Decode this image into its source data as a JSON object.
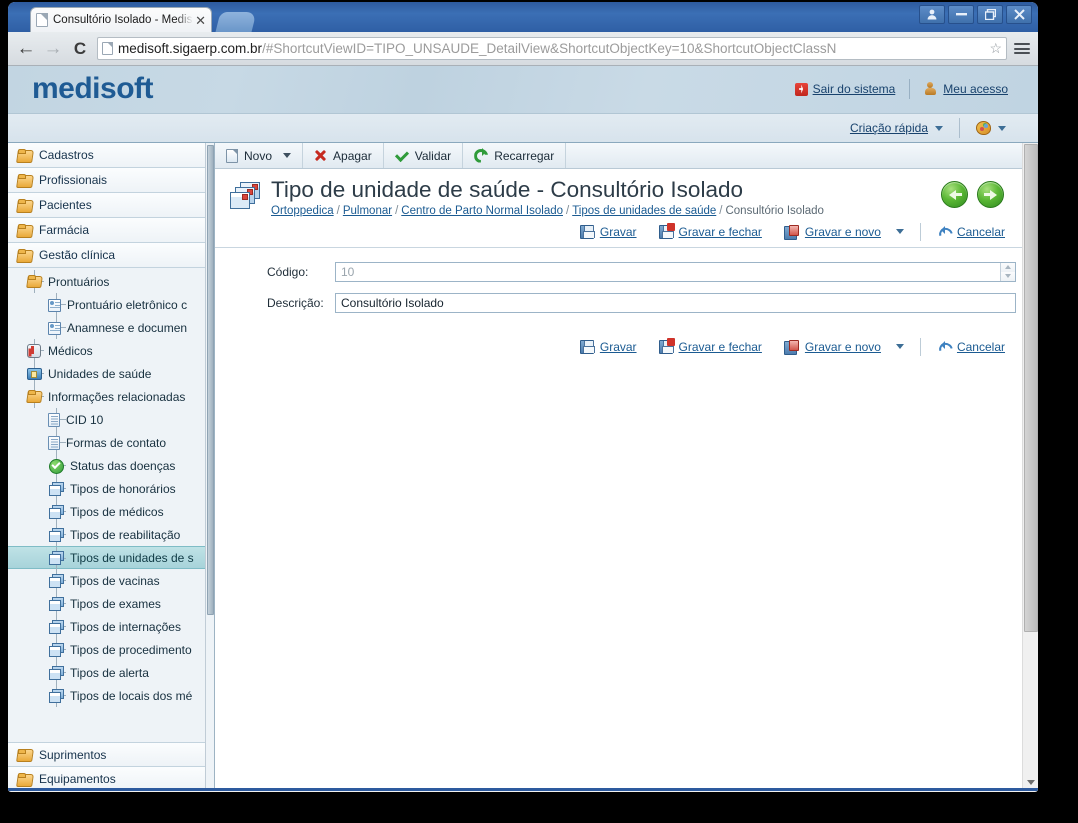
{
  "browser": {
    "tab_title": "Consultório Isolado - Medisof",
    "tab_close": "✕",
    "url_host": "medisoft.sigaerp.com.br",
    "url_path": "/#ShortcutViewID=TIPO_UNSAUDE_DetailView&ShortcutObjectKey=10&ShortcutObjectClassN",
    "back": "←",
    "forward": "→",
    "reload": "C",
    "star": "☆",
    "window_controls": [
      "user-icon",
      "minimize",
      "restore",
      "close"
    ]
  },
  "app": {
    "logo": "medisoft",
    "header_links": [
      {
        "label": "Sair do sistema",
        "icon": "exit-icon"
      },
      {
        "label": "Meu acesso",
        "icon": "user-icon"
      }
    ],
    "subheader": {
      "quick_create": "Criação rápida",
      "theme_icon": "palette-icon"
    }
  },
  "sidebar": {
    "groups_top": [
      {
        "label": "Cadastros"
      },
      {
        "label": "Profissionais"
      },
      {
        "label": "Pacientes"
      },
      {
        "label": "Farmácia"
      },
      {
        "label": "Gestão clínica"
      }
    ],
    "tree": [
      {
        "label": "Prontuários",
        "level": 1,
        "icon": "folder",
        "expander": "minus",
        "selected": false
      },
      {
        "label": "Prontuário eletrônico c",
        "level": 2,
        "icon": "card",
        "expander": "",
        "selected": false
      },
      {
        "label": "Anamnese e documen",
        "level": 2,
        "icon": "card",
        "expander": "",
        "selected": false
      },
      {
        "label": "Médicos",
        "level": 1,
        "icon": "doctor",
        "expander": "",
        "selected": false
      },
      {
        "label": "Unidades de saúde",
        "level": 1,
        "icon": "house",
        "expander": "",
        "selected": false
      },
      {
        "label": "Informações relacionadas",
        "level": 1,
        "icon": "folder",
        "expander": "minus",
        "selected": false
      },
      {
        "label": "CID 10",
        "level": 2,
        "icon": "doc",
        "expander": "",
        "selected": false
      },
      {
        "label": "Formas de contato",
        "level": 2,
        "icon": "doc",
        "expander": "",
        "selected": false
      },
      {
        "label": "Status das doenças",
        "level": 2,
        "icon": "check",
        "expander": "",
        "selected": false
      },
      {
        "label": "Tipos de honorários",
        "level": 2,
        "icon": "stack",
        "expander": "",
        "selected": false
      },
      {
        "label": "Tipos de médicos",
        "level": 2,
        "icon": "stack",
        "expander": "",
        "selected": false
      },
      {
        "label": "Tipos de reabilitação",
        "level": 2,
        "icon": "stack",
        "expander": "",
        "selected": false
      },
      {
        "label": "Tipos de unidades de s",
        "level": 2,
        "icon": "stack",
        "expander": "",
        "selected": true
      },
      {
        "label": "Tipos de vacinas",
        "level": 2,
        "icon": "stack",
        "expander": "",
        "selected": false
      },
      {
        "label": "Tipos de exames",
        "level": 2,
        "icon": "stack",
        "expander": "",
        "selected": false
      },
      {
        "label": "Tipos de internações",
        "level": 2,
        "icon": "stack",
        "expander": "",
        "selected": false
      },
      {
        "label": "Tipos de procedimento",
        "level": 2,
        "icon": "stack",
        "expander": "",
        "selected": false
      },
      {
        "label": "Tipos de alerta",
        "level": 2,
        "icon": "stack",
        "expander": "",
        "selected": false
      },
      {
        "label": "Tipos de locais dos mé",
        "level": 2,
        "icon": "stack",
        "expander": "",
        "selected": false
      }
    ],
    "groups_bottom": [
      {
        "label": "Suprimentos"
      },
      {
        "label": "Equipamentos"
      }
    ]
  },
  "toolbar": {
    "new": "Novo",
    "delete": "Apagar",
    "validate": "Validar",
    "reload": "Recarregar"
  },
  "page": {
    "title": "Tipo de unidade de saúde - Consultório Isolado",
    "breadcrumb": [
      {
        "label": "Ortoppedica",
        "link": true
      },
      {
        "label": "Pulmonar",
        "link": true
      },
      {
        "label": "Centro de Parto Normal Isolado",
        "link": true
      },
      {
        "label": "Tipos de unidades de saúde",
        "link": true
      },
      {
        "label": "Consultório Isolado",
        "link": false
      }
    ],
    "breadcrumb_sep": "/"
  },
  "actions": {
    "save": "Gravar",
    "save_close": "Gravar e fechar",
    "save_new": "Gravar e novo",
    "cancel": "Cancelar"
  },
  "form": {
    "codigo_label": "Código:",
    "codigo_value": "10",
    "descricao_label": "Descrição:",
    "descricao_value": "Consultório Isolado"
  },
  "colors": {
    "brand_blue": "#1f5b94",
    "link": "#1b5b92",
    "selected_row": "#a7d3da",
    "chrome_title": "#2d5a9e",
    "green": "#2f9b3a",
    "red": "#c62a20"
  }
}
